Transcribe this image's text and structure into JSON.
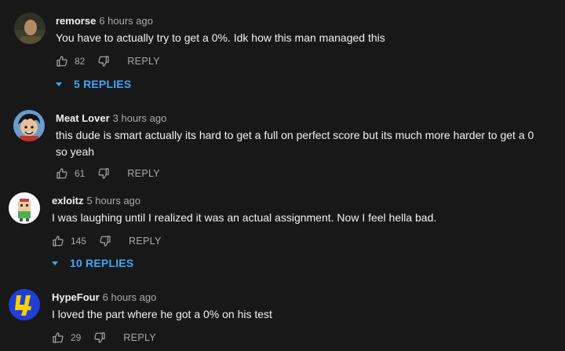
{
  "comments": [
    {
      "author": "remorse",
      "time": "6 hours ago",
      "text": "You have to actually try to get a 0%. Idk how this man managed this",
      "likes": "82",
      "reply_label": "REPLY",
      "replies_label": "5 REPLIES",
      "avatar_icon": "profile-photo"
    },
    {
      "author": "Meat Lover",
      "time": "3 hours ago",
      "text_line1": "this dude is smart actually its hard to get a full on perfect score but its much more harder to get a 0",
      "text_line2": "so yeah",
      "likes": "61",
      "reply_label": "REPLY",
      "avatar_icon": "anime-character-avatar"
    },
    {
      "author": "exloitz",
      "time": "5 hours ago",
      "text": "I was laughing until I realized it was an actual assignment. Now I feel hella bad.",
      "likes": "145",
      "reply_label": "REPLY",
      "replies_label": "10 REPLIES",
      "avatar_icon": "pixel-character-avatar"
    },
    {
      "author": "HypeFour",
      "time": "6 hours ago",
      "text": "I loved the part where he got a 0% on his test",
      "likes": "29",
      "reply_label": "REPLY",
      "avatar_icon": "number-four-logo-avatar"
    }
  ],
  "colors": {
    "background": "#181818",
    "accent": "#3ea6ff",
    "secondary_text": "#aaaaaa"
  }
}
